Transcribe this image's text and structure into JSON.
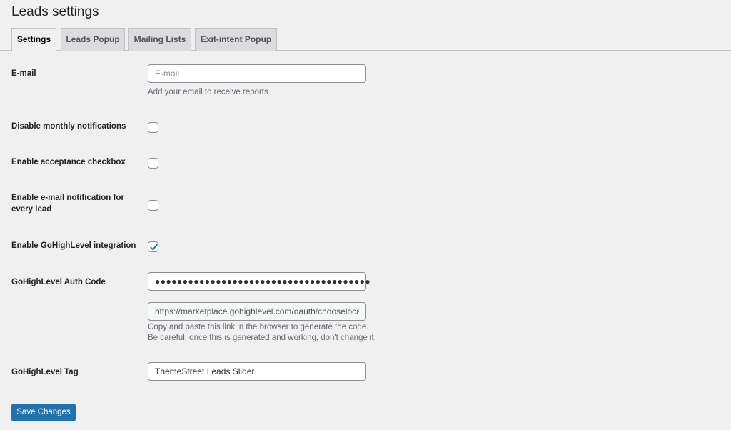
{
  "page": {
    "title": "Leads settings"
  },
  "tabs": [
    {
      "label": "Settings",
      "active": true
    },
    {
      "label": "Leads Popup",
      "active": false
    },
    {
      "label": "Mailing Lists",
      "active": false
    },
    {
      "label": "Exit-intent Popup",
      "active": false
    }
  ],
  "fields": {
    "email": {
      "label": "E-mail",
      "value": "",
      "placeholder": "E-mail",
      "description": "Add your email to receive reports"
    },
    "disable_monthly": {
      "label": "Disable monthly notifications",
      "checked": false
    },
    "acceptance_checkbox": {
      "label": "Enable acceptance checkbox",
      "checked": false
    },
    "email_notification": {
      "label_line1": "Enable e-mail notification for",
      "label_line2": "every lead",
      "checked": false
    },
    "gohighlevel_integration": {
      "label": "Enable GoHighLevel integration",
      "checked": true
    },
    "auth_code": {
      "label": "GoHighLevel Auth Code",
      "masked_value": "●●●●●●●●●●●●●●●●●●●●●●●●●●●●●●●●●●●●●●●",
      "link_value": "https://marketplace.gohighlevel.com/oauth/chooselocation",
      "description_line1": "Copy and paste this link in the browser to generate the code.",
      "description_line2": "Be careful, once this is generated and working, don't change it."
    },
    "tag": {
      "label": "GoHighLevel Tag",
      "value": "ThemeStreet Leads Slider"
    }
  },
  "actions": {
    "save_label": "Save Changes"
  },
  "colors": {
    "primary": "#2271b1",
    "background": "#f0f0f1"
  }
}
